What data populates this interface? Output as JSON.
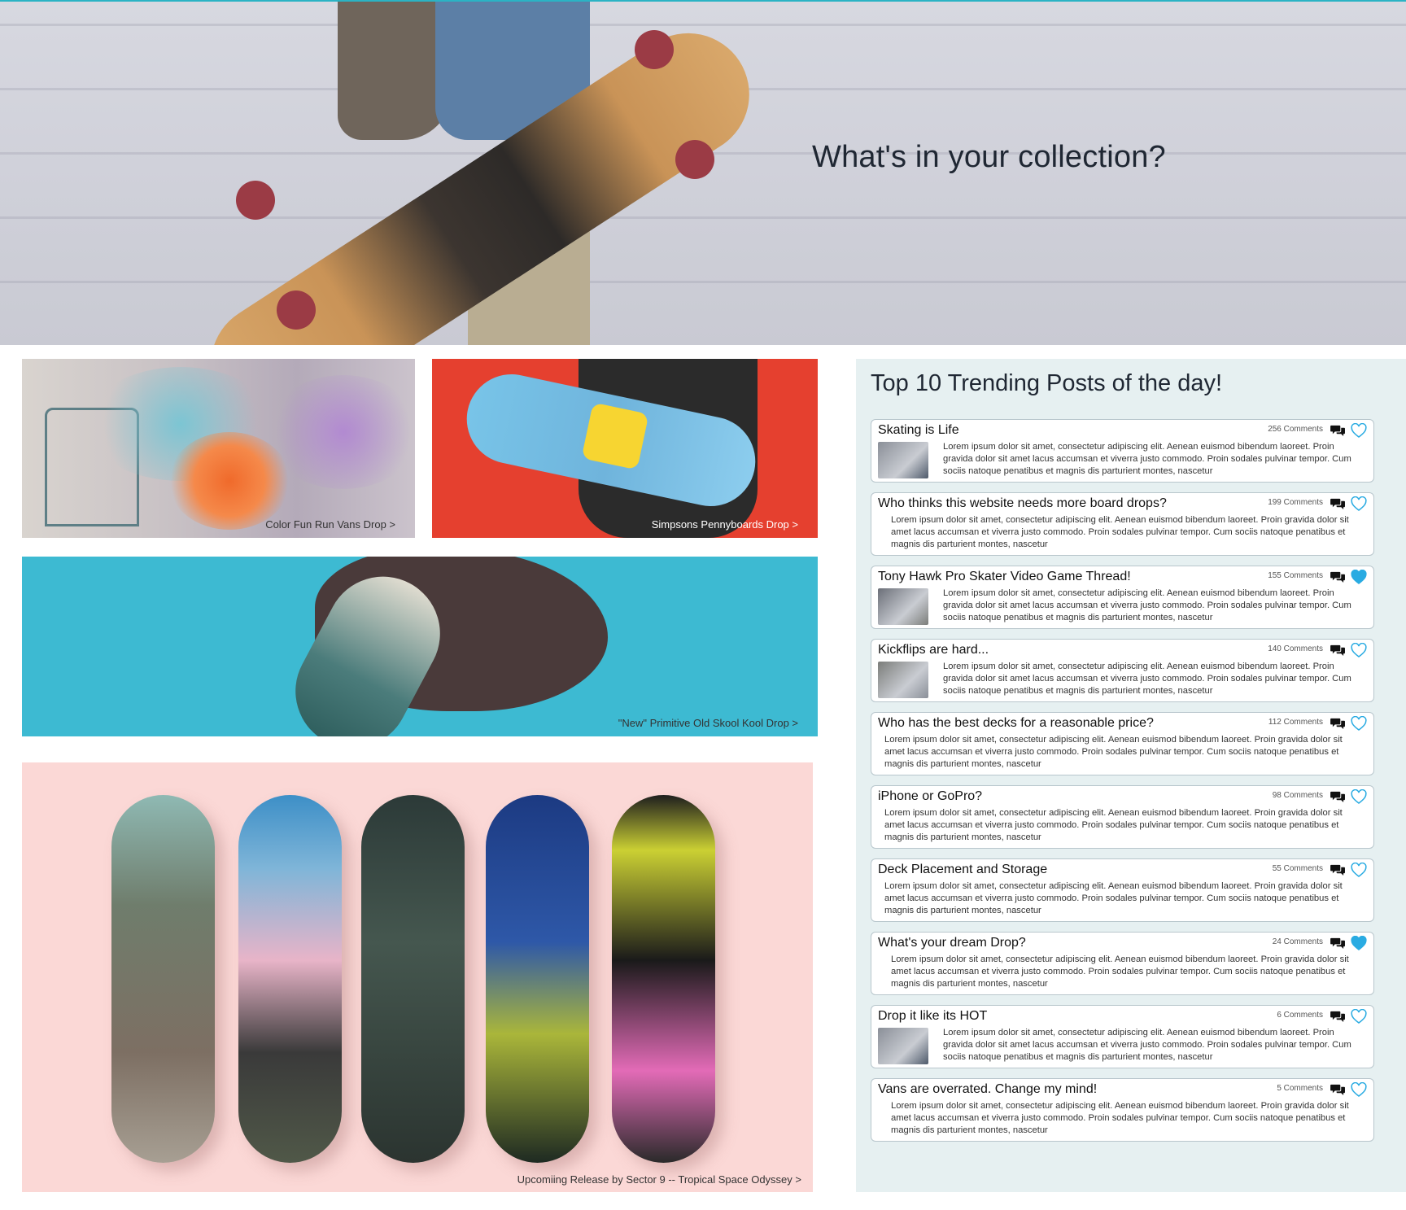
{
  "hero": {
    "title": "What's in your collection?"
  },
  "tiles": {
    "t1": "Color Fun Run Vans Drop  >",
    "t2": "Simpsons Pennyboards Drop  >",
    "t3": "\"New\" Primitive Old Skool Kool Drop  >",
    "t4": "Upcomiing Release by Sector 9 -- Tropical Space Odyssey >"
  },
  "trending": {
    "title": "Top 10 Trending Posts of the day!",
    "posts": [
      {
        "title": "Skating is Life",
        "comments": "256 Comments",
        "body": "Lorem ipsum dolor sit amet, consectetur adipiscing elit. Aenean euismod bibendum laoreet. Proin gravida dolor sit amet lacus accumsan et viverra justo commodo. Proin sodales pulvinar tempor. Cum sociis natoque penatibus et magnis dis parturient montes, nascetur",
        "liked": false,
        "thumb": true
      },
      {
        "title": "Who thinks this website needs more board drops?",
        "comments": "199 Comments",
        "body": "Lorem ipsum dolor sit amet, consectetur adipiscing elit. Aenean euismod bibendum laoreet. Proin gravida dolor sit amet lacus accumsan et viverra justo commodo. Proin sodales pulvinar tempor. Cum sociis natoque penatibus et magnis dis parturient montes, nascetur",
        "liked": false,
        "thumb": false
      },
      {
        "title": "Tony Hawk Pro Skater Video Game Thread!",
        "comments": "155 Comments",
        "body": "Lorem ipsum dolor sit amet, consectetur adipiscing elit. Aenean euismod bibendum laoreet. Proin gravida dolor sit amet lacus accumsan et viverra justo commodo. Proin sodales pulvinar tempor. Cum sociis natoque penatibus et magnis dis parturient montes, nascetur",
        "liked": true,
        "thumb": true
      },
      {
        "title": "Kickflips are hard...",
        "comments": "140 Comments",
        "body": "Lorem ipsum dolor sit amet, consectetur adipiscing elit. Aenean euismod bibendum laoreet. Proin gravida dolor sit amet lacus accumsan et viverra justo commodo. Proin sodales pulvinar tempor. Cum sociis natoque penatibus et magnis dis parturient montes, nascetur",
        "liked": false,
        "thumb": true
      },
      {
        "title": "Who has the best decks for a reasonable price?",
        "comments": "112 Comments",
        "body": "Lorem ipsum dolor sit amet, consectetur adipiscing elit. Aenean euismod bibendum laoreet. Proin gravida dolor sit amet lacus accumsan et viverra justo commodo. Proin sodales pulvinar tempor. Cum sociis natoque penatibus et magnis dis parturient montes, nascetur",
        "liked": false,
        "thumb": false
      },
      {
        "title": "iPhone or GoPro?",
        "comments": "98 Comments",
        "body": "Lorem ipsum dolor sit amet, consectetur adipiscing elit. Aenean euismod bibendum laoreet. Proin gravida dolor sit amet lacus accumsan et viverra justo commodo. Proin sodales pulvinar tempor. Cum sociis natoque penatibus et magnis dis parturient montes, nascetur",
        "liked": false,
        "thumb": false
      },
      {
        "title": "Deck Placement and Storage",
        "comments": "55 Comments",
        "body": "Lorem ipsum dolor sit amet, consectetur adipiscing elit. Aenean euismod bibendum laoreet. Proin gravida dolor sit amet lacus accumsan et viverra justo commodo. Proin sodales pulvinar tempor. Cum sociis natoque penatibus et magnis dis parturient montes, nascetur",
        "liked": false,
        "thumb": false
      },
      {
        "title": "What's your dream Drop?",
        "comments": "24 Comments",
        "body": "Lorem ipsum dolor sit amet, consectetur adipiscing elit. Aenean euismod bibendum laoreet. Proin gravida dolor sit amet lacus accumsan et viverra justo commodo. Proin sodales pulvinar tempor. Cum sociis natoque penatibus et magnis dis parturient montes, nascetur",
        "liked": true,
        "thumb": false
      },
      {
        "title": "Drop it like its HOT",
        "comments": "6 Comments",
        "body": "Lorem ipsum dolor sit amet, consectetur adipiscing elit. Aenean euismod bibendum laoreet. Proin gravida dolor sit amet lacus accumsan et viverra justo commodo. Proin sodales pulvinar tempor. Cum sociis natoque penatibus et magnis dis parturient montes, nascetur",
        "liked": false,
        "thumb": true
      },
      {
        "title": "Vans are overrated. Change my mind!",
        "comments": "5 Comments",
        "body": "Lorem ipsum dolor sit amet, consectetur adipiscing elit. Aenean euismod bibendum laoreet. Proin gravida dolor sit amet lacus accumsan et viverra justo commodo. Proin sodales pulvinar tempor. Cum sociis natoque penatibus et magnis dis parturient montes, nascetur",
        "liked": false,
        "thumb": false
      }
    ]
  },
  "colors": {
    "accent": "#29abe2",
    "panel_bg": "#e6f0f1",
    "title": "#1f2733"
  },
  "icons": {
    "comments": "comments-icon",
    "like": "heart-icon"
  }
}
